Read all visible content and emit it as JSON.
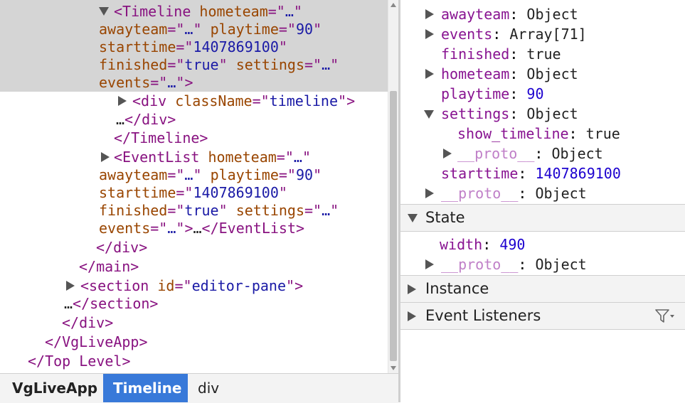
{
  "tree": {
    "selected_timeline": {
      "line1": {
        "open": "<Timeline",
        "a1": "hometeam",
        "eq": "=\"",
        "v1": "…",
        "q": "\""
      },
      "line2": {
        "a1": "awayteam",
        "v1": "…",
        "a2": "playtime",
        "v2": "90"
      },
      "line3": {
        "a1": "starttime",
        "v1": "1407869100"
      },
      "line4": {
        "a1": "finished",
        "v1": "true",
        "a2": "settings",
        "v2": "…"
      },
      "line5": {
        "a1": "events",
        "v1": "…",
        "close": ">"
      }
    },
    "div_timeline": {
      "open": "<div",
      "a1": "className",
      "v1": "timeline",
      "close": ">"
    },
    "div_timeline_close": {
      "ellipsis": "…",
      "close": "</div>"
    },
    "timeline_close": "</Timeline>",
    "eventlist": {
      "line1": {
        "open": "<EventList",
        "a1": "hometeam",
        "v1": "…"
      },
      "line2": {
        "a1": "awayteam",
        "v1": "…",
        "a2": "playtime",
        "v2": "90"
      },
      "line3": {
        "a1": "starttime",
        "v1": "1407869100"
      },
      "line4": {
        "a1": "finished",
        "v1": "true",
        "a2": "settings",
        "v2": "…"
      },
      "line5": {
        "a1": "events",
        "v1": "…",
        "close": ">",
        "ellipsis": "…",
        "end": "</EventList>"
      }
    },
    "div_close": "</div>",
    "main_close": "</main>",
    "section": {
      "open": "<section",
      "a1": "id",
      "v1": "editor-pane",
      "close": ">"
    },
    "section_close": {
      "ellipsis": "…",
      "close": "</section>"
    },
    "div_close2": "</div>",
    "app_close": "</VgLiveApp>",
    "top_close": "</Top Level>"
  },
  "breadcrumb": [
    "VgLiveApp",
    "Timeline",
    "div"
  ],
  "props": {
    "awayteam": {
      "key": "awayteam",
      "value": "Object"
    },
    "events": {
      "key": "events",
      "value": "Array[71]"
    },
    "finished": {
      "key": "finished",
      "value": "true"
    },
    "hometeam": {
      "key": "hometeam",
      "value": "Object"
    },
    "playtime": {
      "key": "playtime",
      "value": "90"
    },
    "settings": {
      "key": "settings",
      "value": "Object"
    },
    "show_timeline": {
      "key": "show_timeline",
      "value": "true"
    },
    "settings_proto": {
      "key": "__proto__",
      "value": "Object"
    },
    "starttime": {
      "key": "starttime",
      "value": "1407869100"
    },
    "proto": {
      "key": "__proto__",
      "value": "Object"
    }
  },
  "sections": {
    "state": {
      "title": "State",
      "width": {
        "key": "width",
        "value": "490"
      },
      "proto": {
        "key": "__proto__",
        "value": "Object"
      }
    },
    "instance": {
      "title": "Instance"
    },
    "event_listeners": {
      "title": "Event Listeners",
      "icon": "filter-icon"
    }
  },
  "colors": {
    "tag": "#881280",
    "attr_name": "#994500",
    "attr_value": "#1a1aa6",
    "selected_bg": "#d5d5d5",
    "active_crumb": "#3879d9",
    "prop_key": "#881391",
    "number": "#1c00cf"
  }
}
